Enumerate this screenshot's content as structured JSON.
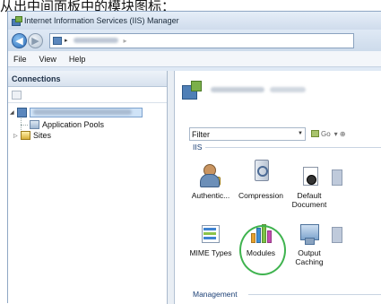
{
  "caption": "从出中间面板中的模块图标：",
  "window": {
    "title": "Internet Information Services (IIS) Manager"
  },
  "nav": {
    "back_icon": "back-arrow-icon",
    "forward_icon": "forward-arrow-icon",
    "address_arrow": "▸"
  },
  "menu": {
    "file": "File",
    "view": "View",
    "help": "Help"
  },
  "connections": {
    "title": "Connections",
    "tree": {
      "app_pools": "Application Pools",
      "sites": "Sites"
    }
  },
  "main": {
    "filter_label": "Filter",
    "go_label": "Go",
    "section_iis": "IIS",
    "section_management": "Management",
    "features": {
      "authentication": "Authentic...",
      "compression": "Compression",
      "default_document": "Default\nDocument",
      "mime_types": "MIME Types",
      "modules": "Modules",
      "output_caching": "Output\nCaching"
    }
  },
  "highlight_color": "#3fb34f"
}
